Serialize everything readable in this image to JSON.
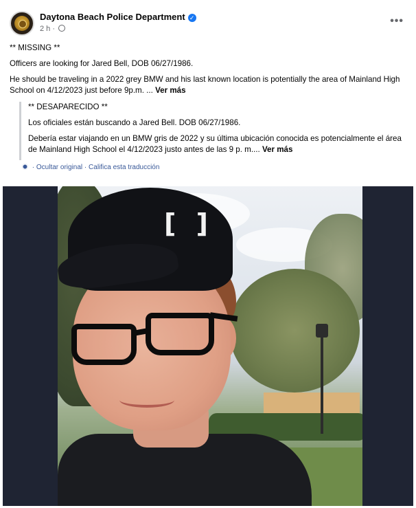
{
  "post": {
    "page_name": "Daytona Beach Police Department",
    "verified_mark": "✓",
    "time": "2 h",
    "meta_separator": " · ",
    "more_label": "•••"
  },
  "original": {
    "line1": "** MISSING **",
    "line2": "Officers are looking for Jared Bell, DOB 06/27/1986.",
    "line3": "He should be traveling in a 2022 grey BMW and his last known location is potentially the area of Mainland High School on 4/12/2023 just before 9p.m. ...",
    "see_more": "Ver más"
  },
  "translation": {
    "line1": "** DESAPARECIDO **",
    "line2": "Los oficiales están buscando a Jared Bell. DOB 06/27/1986.",
    "line3": "Debería estar viajando en un BMW gris de 2022 y su última ubicación conocida es potencialmente el área de Mainland High School el 4/12/2023 justo antes de las 9 p. m....",
    "see_more": "Ver más",
    "hide_original": "Ocultar original",
    "separator": " · ",
    "rate_translation": "Califica esta traducción"
  },
  "icons": {
    "avatar": "police-badge-icon",
    "verified": "verified-badge-icon",
    "audience": "globe-icon",
    "more": "more-options-icon",
    "translation": "gear-icon"
  },
  "colors": {
    "link": "#385898",
    "verified": "#1877f2",
    "muted": "#65676b",
    "photo_background": "#1f2433"
  }
}
